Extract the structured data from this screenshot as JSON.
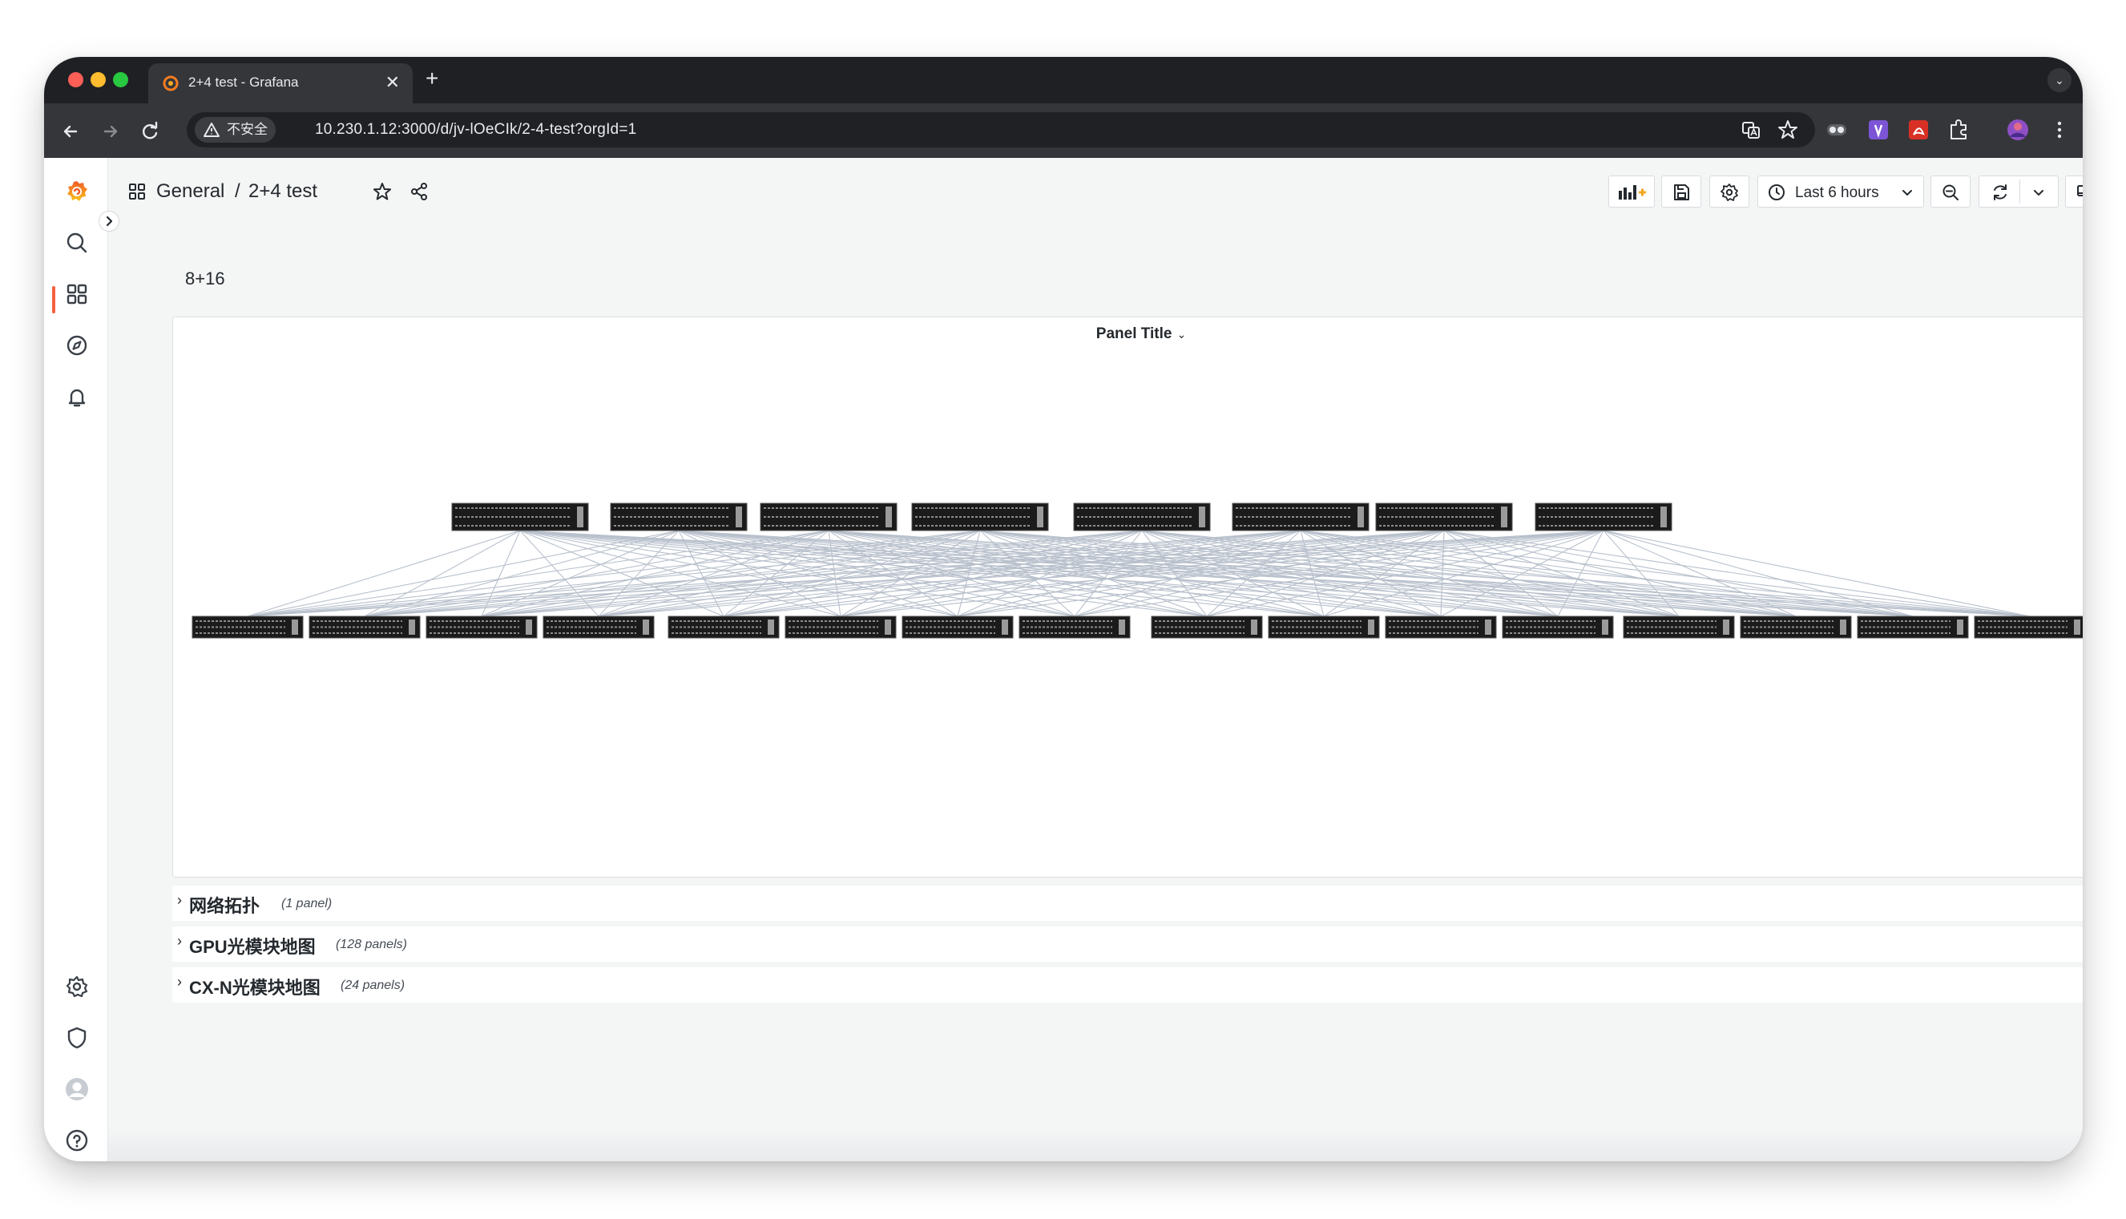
{
  "browser": {
    "tab_title": "2+4 test - Grafana",
    "insecure_label": "不安全",
    "url": "10.230.1.12:3000/d/jv-lOeCIk/2-4-test?orgId=1"
  },
  "breadcrumb": {
    "folder": "General",
    "separator": "/",
    "title": "2+4 test"
  },
  "toolbar": {
    "time_range": "Last 6 hours"
  },
  "variables": {
    "text": "8+16"
  },
  "panel": {
    "title": "Panel Title",
    "topology": {
      "spine_count": 8,
      "leaf_count": 16
    }
  },
  "rows": [
    {
      "title": "网络拓扑",
      "count": "(1 panel)"
    },
    {
      "title": "GPU光模块地图",
      "count": "(128 panels)"
    },
    {
      "title": "CX-N光模块地图",
      "count": "(24 panels)"
    }
  ],
  "colors": {
    "grafana_orange": "#f55f3e",
    "link": "#b8c0cc",
    "switch_body": "#1b1b1b"
  },
  "icons": {
    "sidebar": [
      "grafana-logo-icon",
      "search-icon",
      "dashboards-icon",
      "explore-icon",
      "alerting-icon",
      "configuration-icon",
      "server-admin-icon",
      "user-avatar-icon",
      "help-icon"
    ]
  }
}
